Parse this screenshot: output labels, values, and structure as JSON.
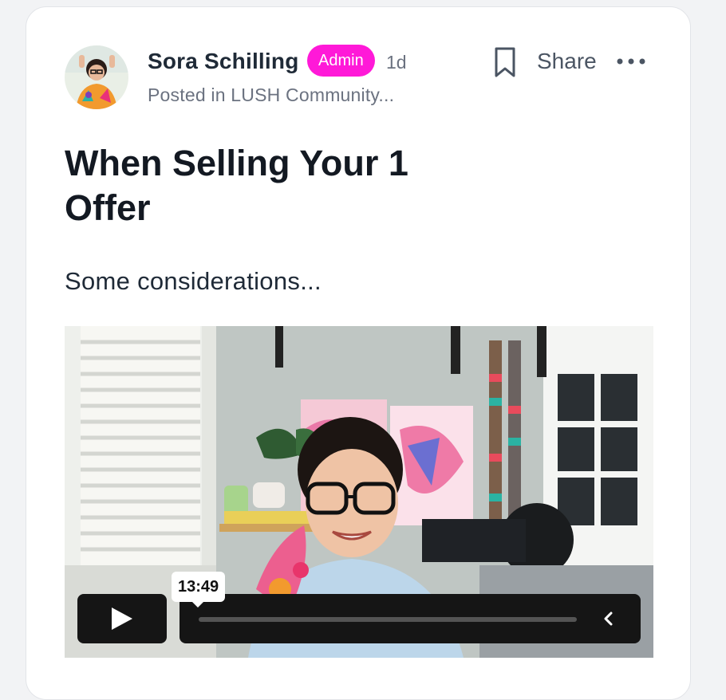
{
  "post": {
    "author": "Sora Schilling",
    "badge": "Admin",
    "time_ago": "1d",
    "posted_in": "Posted in LUSH Community...",
    "title": "When Selling Your 1 Offer",
    "body": "Some considerations..."
  },
  "actions": {
    "share_label": "Share",
    "bookmark_icon": "bookmark-icon",
    "more_icon": "ellipsis-icon"
  },
  "video": {
    "duration": "13:49",
    "progress": 0.0,
    "play_icon": "play-icon",
    "collapse_icon": "chevron-left-icon"
  },
  "colors": {
    "badge_bg": "#ff19d8",
    "title": "#131922",
    "muted": "#6b7280",
    "video_controls": "#151515"
  }
}
